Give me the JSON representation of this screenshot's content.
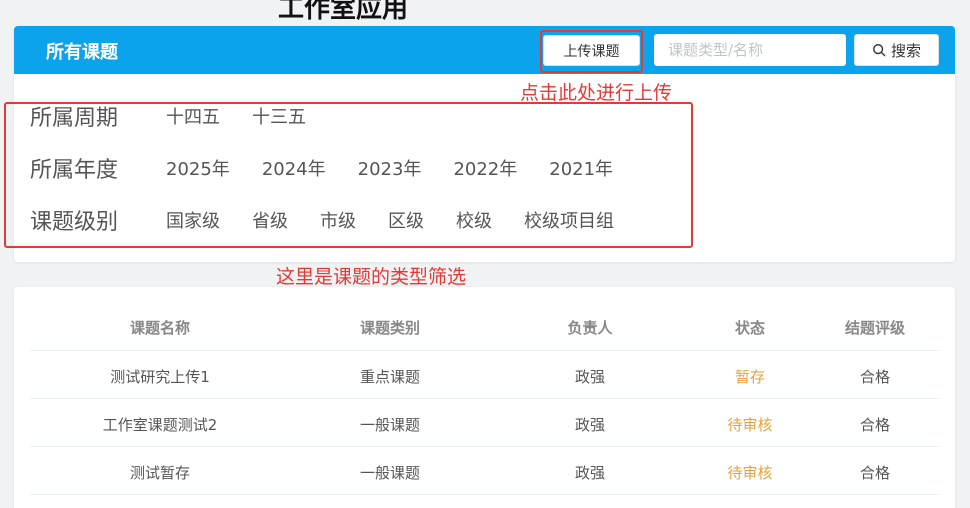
{
  "page_heading": "工作室应用",
  "header": {
    "title": "所有课题",
    "upload_label": "上传课题",
    "search_placeholder": "课题类型/名称",
    "search_label": "搜索"
  },
  "filters": [
    {
      "label": "所属周期",
      "options": [
        "十四五",
        "十三五"
      ]
    },
    {
      "label": "所属年度",
      "options": [
        "2025年",
        "2024年",
        "2023年",
        "2022年",
        "2021年"
      ]
    },
    {
      "label": "课题级别",
      "options": [
        "国家级",
        "省级",
        "市级",
        "区级",
        "校级",
        "校级项目组"
      ]
    }
  ],
  "annotations": {
    "upload_note": "点击此处进行上传",
    "filter_note": "这里是课题的类型筛选"
  },
  "table": {
    "columns": [
      "课题名称",
      "课题类别",
      "负责人",
      "状态",
      "结题评级"
    ],
    "rows": [
      [
        "测试研究上传1",
        "重点课题",
        "政强",
        "暂存",
        "合格"
      ],
      [
        "工作室课题测试2",
        "一般课题",
        "政强",
        "待审核",
        "合格"
      ],
      [
        "测试暂存",
        "一般课题",
        "政强",
        "待审核",
        "合格"
      ]
    ]
  },
  "colors": {
    "header_bar": "#0aa3ec",
    "status": "#e6a23c",
    "annotation": "#e53935"
  }
}
